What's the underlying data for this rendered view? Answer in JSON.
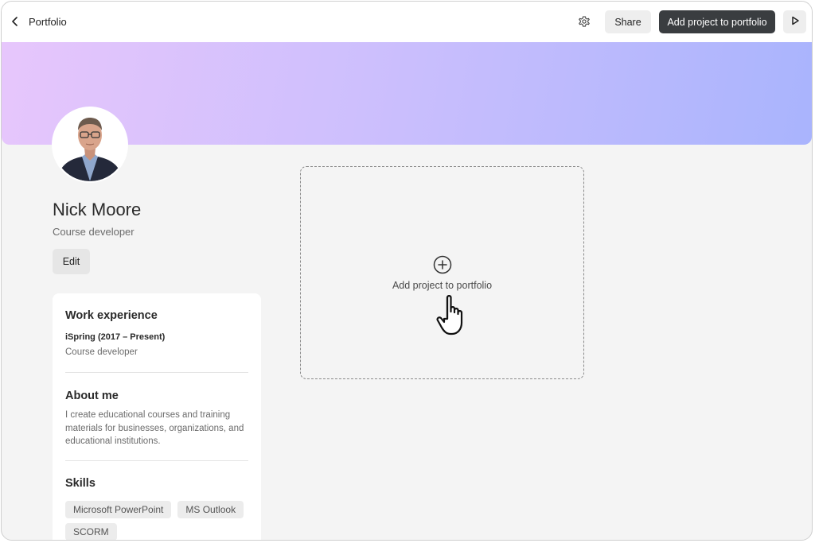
{
  "header": {
    "back_label": "Portfolio",
    "share_label": "Share",
    "add_project_label": "Add project to portfolio",
    "icons": {
      "back": "chevron-left-icon",
      "settings": "gear-icon",
      "preview": "play-icon"
    }
  },
  "profile": {
    "name": "Nick Moore",
    "role": "Course developer",
    "edit_label": "Edit"
  },
  "info_card": {
    "work_title": "Work experience",
    "job_company": "iSpring (2017 – Present)",
    "job_role": "Course developer",
    "about_title": "About me",
    "about_text": "I create educational courses and training materials for businesses, organizations, and educational institutions.",
    "skills_title": "Skills",
    "skills": [
      "Microsoft PowerPoint",
      "MS Outlook",
      "SCORM"
    ]
  },
  "dropzone": {
    "label": "Add project to portfolio",
    "icon": "plus-circle-icon"
  },
  "colors": {
    "banner_start": "#e7c6fc",
    "banner_end": "#a9b4fd",
    "primary_button": "#3a3d40",
    "background": "#f4f4f4"
  }
}
